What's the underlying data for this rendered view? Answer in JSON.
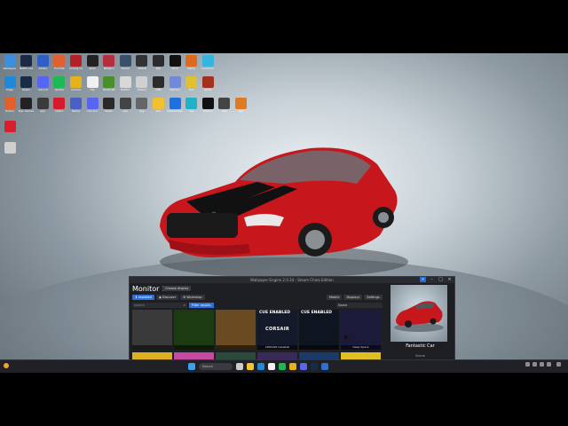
{
  "desktop": {
    "icons_row1": [
      {
        "label": "Wallpaper",
        "color": "#3b8fe0"
      },
      {
        "label": "Battle.net",
        "color": "#1b2a44"
      },
      {
        "label": "Adobe",
        "color": "#2f5fc4"
      },
      {
        "label": "Fortnite",
        "color": "#e0612f"
      },
      {
        "label": "Among Us",
        "color": "#b3202a"
      },
      {
        "label": "Apex",
        "color": "#222"
      },
      {
        "label": "Blizzard",
        "color": "#b32f3f"
      },
      {
        "label": "Steam",
        "color": "#3a4f6a"
      },
      {
        "label": "Ubisoft",
        "color": "#333"
      },
      {
        "label": "App",
        "color": "#2c2c2c"
      },
      {
        "label": "Xbox",
        "color": "#111"
      },
      {
        "label": "Game",
        "color": "#e06a1b"
      },
      {
        "label": "Launcher",
        "color": "#35b4e0"
      }
    ],
    "icons_row2": [
      {
        "label": "Edge",
        "color": "#1c8ad8"
      },
      {
        "label": "Steam",
        "color": "#1a2c45"
      },
      {
        "label": "Discord",
        "color": "#5865f2"
      },
      {
        "label": "Spotify",
        "color": "#1db954"
      },
      {
        "label": "Chrome",
        "color": "#e6b21a"
      },
      {
        "label": "File",
        "color": "#f0f0f0"
      },
      {
        "label": "Minecraft",
        "color": "#4a8e2b"
      },
      {
        "label": "NVIDIA",
        "color": "#d8d8d8"
      },
      {
        "label": "Roblox",
        "color": "#d0d0d0"
      },
      {
        "label": "OBS",
        "color": "#2c2c2c"
      },
      {
        "label": "Discord",
        "color": "#7289da"
      },
      {
        "label": "Tool",
        "color": "#e0c030"
      },
      {
        "label": "Game",
        "color": "#a3301f"
      }
    ],
    "icons_row3": [
      {
        "label": "Firefox",
        "color": "#e65f2a"
      },
      {
        "label": "Epic Games",
        "color": "#222"
      },
      {
        "label": "App",
        "color": "#3b3b3b"
      },
      {
        "label": "Opera",
        "color": "#d31b2b"
      },
      {
        "label": "Teams",
        "color": "#4a5fc4"
      },
      {
        "label": "Discord",
        "color": "#5865f2"
      },
      {
        "label": "Steam",
        "color": "#2a2a2a"
      },
      {
        "label": "App",
        "color": "#444"
      },
      {
        "label": "App",
        "color": "#666"
      },
      {
        "label": "Tool",
        "color": "#f0c030"
      },
      {
        "label": "Malwarebytes",
        "color": "#1f6fe0"
      },
      {
        "label": "App",
        "color": "#20b0c8"
      },
      {
        "label": "Wacom",
        "color": "#111"
      },
      {
        "label": "App",
        "color": "#444"
      },
      {
        "label": "App",
        "color": "#e07a20"
      }
    ],
    "side_icons": [
      {
        "label": "",
        "color": "#d81f2b"
      },
      {
        "label": "",
        "color": "#cfcfcf"
      }
    ]
  },
  "we": {
    "title": "Wallpaper Engine 2.0.34 - Steam China Edition",
    "monitor": "Monitor 1",
    "choose_display": "Choose display",
    "tabs": [
      "Installed",
      "Discover",
      "Workshop"
    ],
    "right_buttons": [
      "Mobile",
      "Displays",
      "Settings"
    ],
    "search_placeholder": "Search",
    "filter_label": "Filter results",
    "sort_label": "Name",
    "tiles": [
      {
        "label": "",
        "bg": "#3a3a3a"
      },
      {
        "label": "",
        "bg": "#1d3b12"
      },
      {
        "label": "",
        "bg": "#6a4a20"
      },
      {
        "label": "CORSAIR Celestial",
        "bg": "#151a2a",
        "cue": "CUE ENABLED",
        "brand": "CORSAIR"
      },
      {
        "label": "",
        "bg": "#0f1520",
        "cue": "CUE ENABLED",
        "brand": ""
      },
      {
        "label": "Deep Space",
        "bg": "#1b1a3a"
      }
    ],
    "preview": {
      "name": "Fantastic Car",
      "meta": "Scene"
    }
  },
  "taskbar": {
    "weather_temp": "",
    "weather_desc": "",
    "search": "Search",
    "time": "",
    "date": ""
  }
}
